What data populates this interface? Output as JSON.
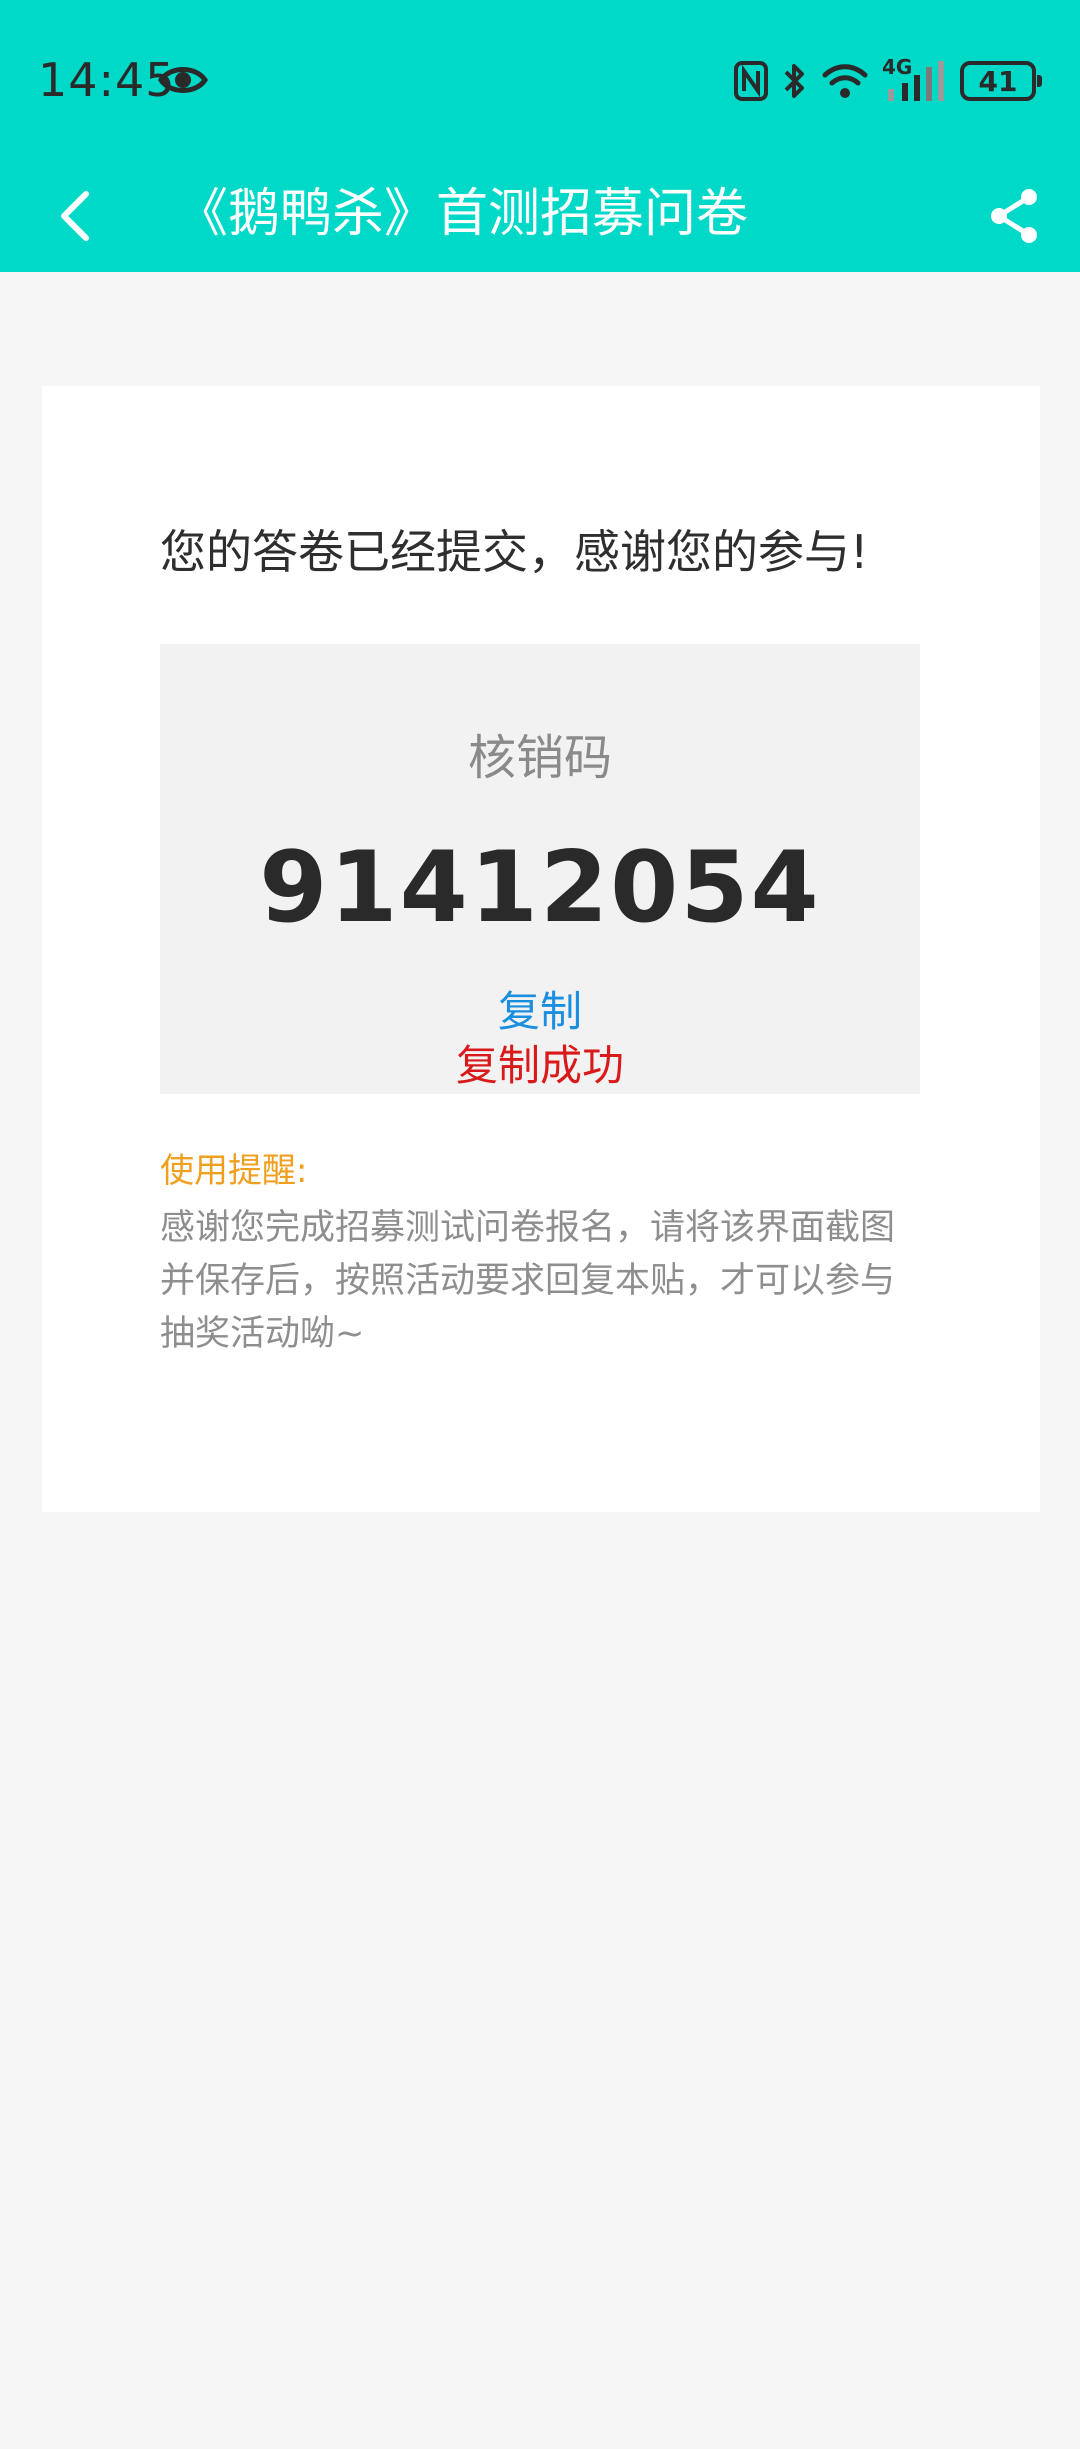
{
  "status_bar": {
    "time": "14:45",
    "network": "4G",
    "battery": "41"
  },
  "nav": {
    "title": "《鹅鸭杀》首测招募问卷"
  },
  "card": {
    "success_message": "您的答卷已经提交，感谢您的参与!",
    "code_label": "核销码",
    "code_value": "91412054",
    "copy_label": "复制",
    "copy_success": "复制成功",
    "tip_title": "使用提醒:",
    "tip_body": "感谢您完成招募测试问卷报名，请将该界面截图并保存后，按照活动要求回复本贴，才可以参与抽奖活动呦~"
  },
  "colors": {
    "header_bg": "#00d8c8",
    "copy_link": "#1a8fe0",
    "copy_success": "#d91a1a",
    "tip_title": "#f0a020"
  },
  "icons": {
    "status": [
      "eye-icon",
      "nfc-icon",
      "bluetooth-icon",
      "wifi-icon",
      "signal-icon",
      "battery-icon"
    ],
    "nav": [
      "back-arrow-icon",
      "share-icon"
    ]
  }
}
